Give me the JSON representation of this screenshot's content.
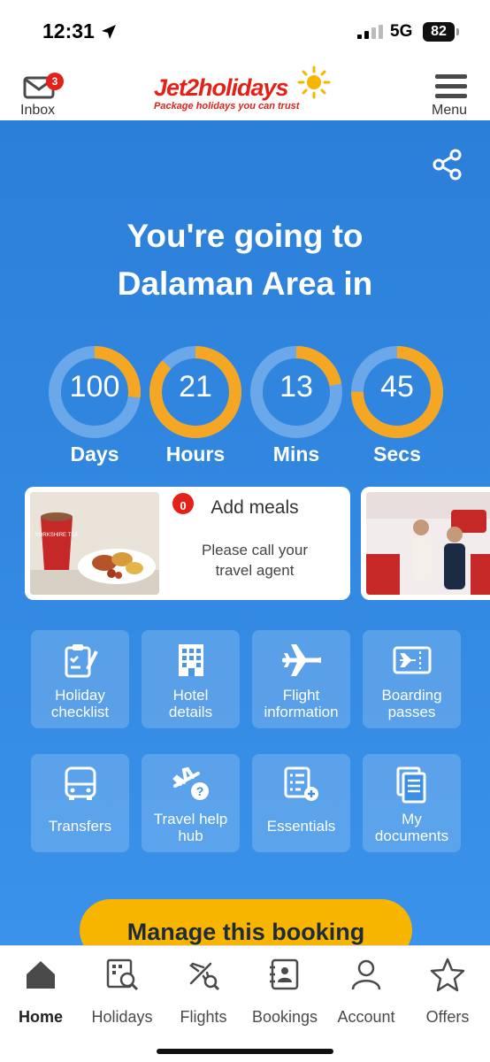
{
  "status_bar": {
    "time": "12:31",
    "network": "5G",
    "battery": "82"
  },
  "header": {
    "inbox_label": "Inbox",
    "inbox_count": "3",
    "logo_text": "Jet2holidays",
    "logo_tagline": "Package holidays you can trust",
    "menu_label": "Menu"
  },
  "hero": {
    "headline_line1": "You're going to",
    "headline_line2": "Dalaman Area in"
  },
  "countdown": [
    {
      "value": "100",
      "label": "Days",
      "progress": 0.27
    },
    {
      "value": "21",
      "label": "Hours",
      "progress": 0.87
    },
    {
      "value": "13",
      "label": "Mins",
      "progress": 0.22
    },
    {
      "value": "45",
      "label": "Secs",
      "progress": 0.75
    }
  ],
  "cards": {
    "meals": {
      "badge": "0",
      "title": "Add meals",
      "subtitle_line1": "Please call your",
      "subtitle_line2": "travel agent",
      "cup_text": "YORKSHIRE TEA"
    }
  },
  "tiles": [
    {
      "line1": "Holiday",
      "line2": "checklist",
      "icon": "clipboard-check-icon"
    },
    {
      "line1": "Hotel",
      "line2": "details",
      "icon": "hotel-icon"
    },
    {
      "line1": "Flight",
      "line2": "information",
      "icon": "plane-icon"
    },
    {
      "line1": "Boarding",
      "line2": "passes",
      "icon": "boarding-pass-icon"
    },
    {
      "line1": "Transfers",
      "line2": "",
      "icon": "bus-icon"
    },
    {
      "line1": "Travel help",
      "line2": "hub",
      "icon": "plane-help-icon"
    },
    {
      "line1": "Essentials",
      "line2": "",
      "icon": "checklist-add-icon"
    },
    {
      "line1": "My",
      "line2": "documents",
      "icon": "documents-icon"
    }
  ],
  "manage_button": "Manage this booking",
  "bottom_nav": [
    {
      "label": "Home",
      "icon": "home-icon",
      "active": true
    },
    {
      "label": "Holidays",
      "icon": "holidays-search-icon",
      "active": false
    },
    {
      "label": "Flights",
      "icon": "flight-search-icon",
      "active": false
    },
    {
      "label": "Bookings",
      "icon": "bookings-icon",
      "active": false
    },
    {
      "label": "Account",
      "icon": "account-icon",
      "active": false
    },
    {
      "label": "Offers",
      "icon": "star-icon",
      "active": false
    }
  ],
  "colors": {
    "accent_orange": "#f5a623",
    "ring_track": "#6aa8ea",
    "brand_red": "#e32119",
    "button_yellow": "#f7b500",
    "blue_background": "#2b7fd8"
  }
}
